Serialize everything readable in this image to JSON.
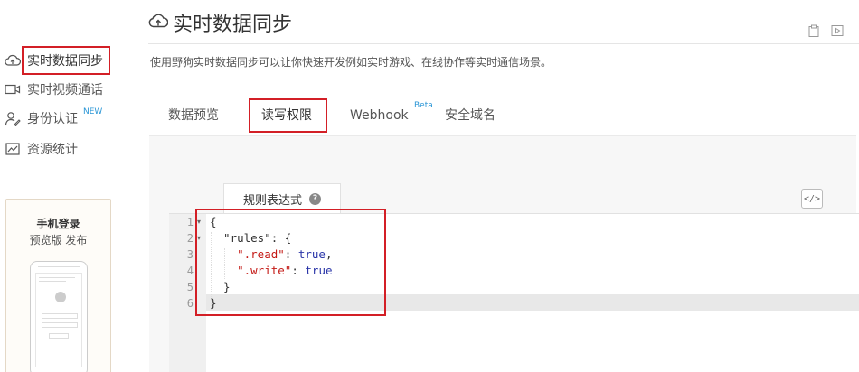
{
  "sidebar": {
    "items": [
      {
        "label": "实时数据同步",
        "icon": "cloud-sync-icon",
        "active": true
      },
      {
        "label": "实时视频通话",
        "icon": "video-camera-icon",
        "active": false
      },
      {
        "label": "身份认证",
        "icon": "user-edit-icon",
        "active": false,
        "badge": "NEW"
      },
      {
        "label": "资源统计",
        "icon": "chart-icon",
        "active": false
      }
    ],
    "mobile_login": {
      "title": "手机登录",
      "subtitle": "预览版 发布"
    }
  },
  "header": {
    "title": "实时数据同步",
    "title_icon": "cloud-sync-icon",
    "description": "使用野狗实时数据同步可以让你快速开发例如实时游戏、在线协作等实时通信场景。",
    "top_icons": [
      "clipboard-icon",
      "play-icon"
    ]
  },
  "tabs": [
    {
      "label": "数据预览",
      "active": false
    },
    {
      "label": "读写权限",
      "active": true
    },
    {
      "label": "Webhook",
      "active": false,
      "badge": "Beta"
    },
    {
      "label": "安全域名",
      "active": false
    }
  ],
  "editor": {
    "subtab_label": "规则表达式",
    "help_glyph": "?",
    "code_toggle_glyph": "</>",
    "line_numbers": [
      "1",
      "2",
      "3",
      "4",
      "5",
      "6"
    ],
    "fold_markers": [
      "▾",
      "▾",
      "",
      "",
      "",
      ""
    ],
    "lines": [
      {
        "t1": "{"
      },
      {
        "t1": "  \"rules\": {"
      },
      {
        "t1": "    ",
        "s": "\".read\"",
        "t2": ": ",
        "b": "true",
        "t3": ","
      },
      {
        "t1": "    ",
        "s": "\".write\"",
        "t2": ": ",
        "b": "true"
      },
      {
        "t1": "  }"
      },
      {
        "t1": "}"
      }
    ]
  },
  "colors": {
    "accent_red": "#d31f26",
    "badge_blue": "#2a96d6",
    "string_red": "#c41a16",
    "bool_blue": "#2a35a8"
  }
}
